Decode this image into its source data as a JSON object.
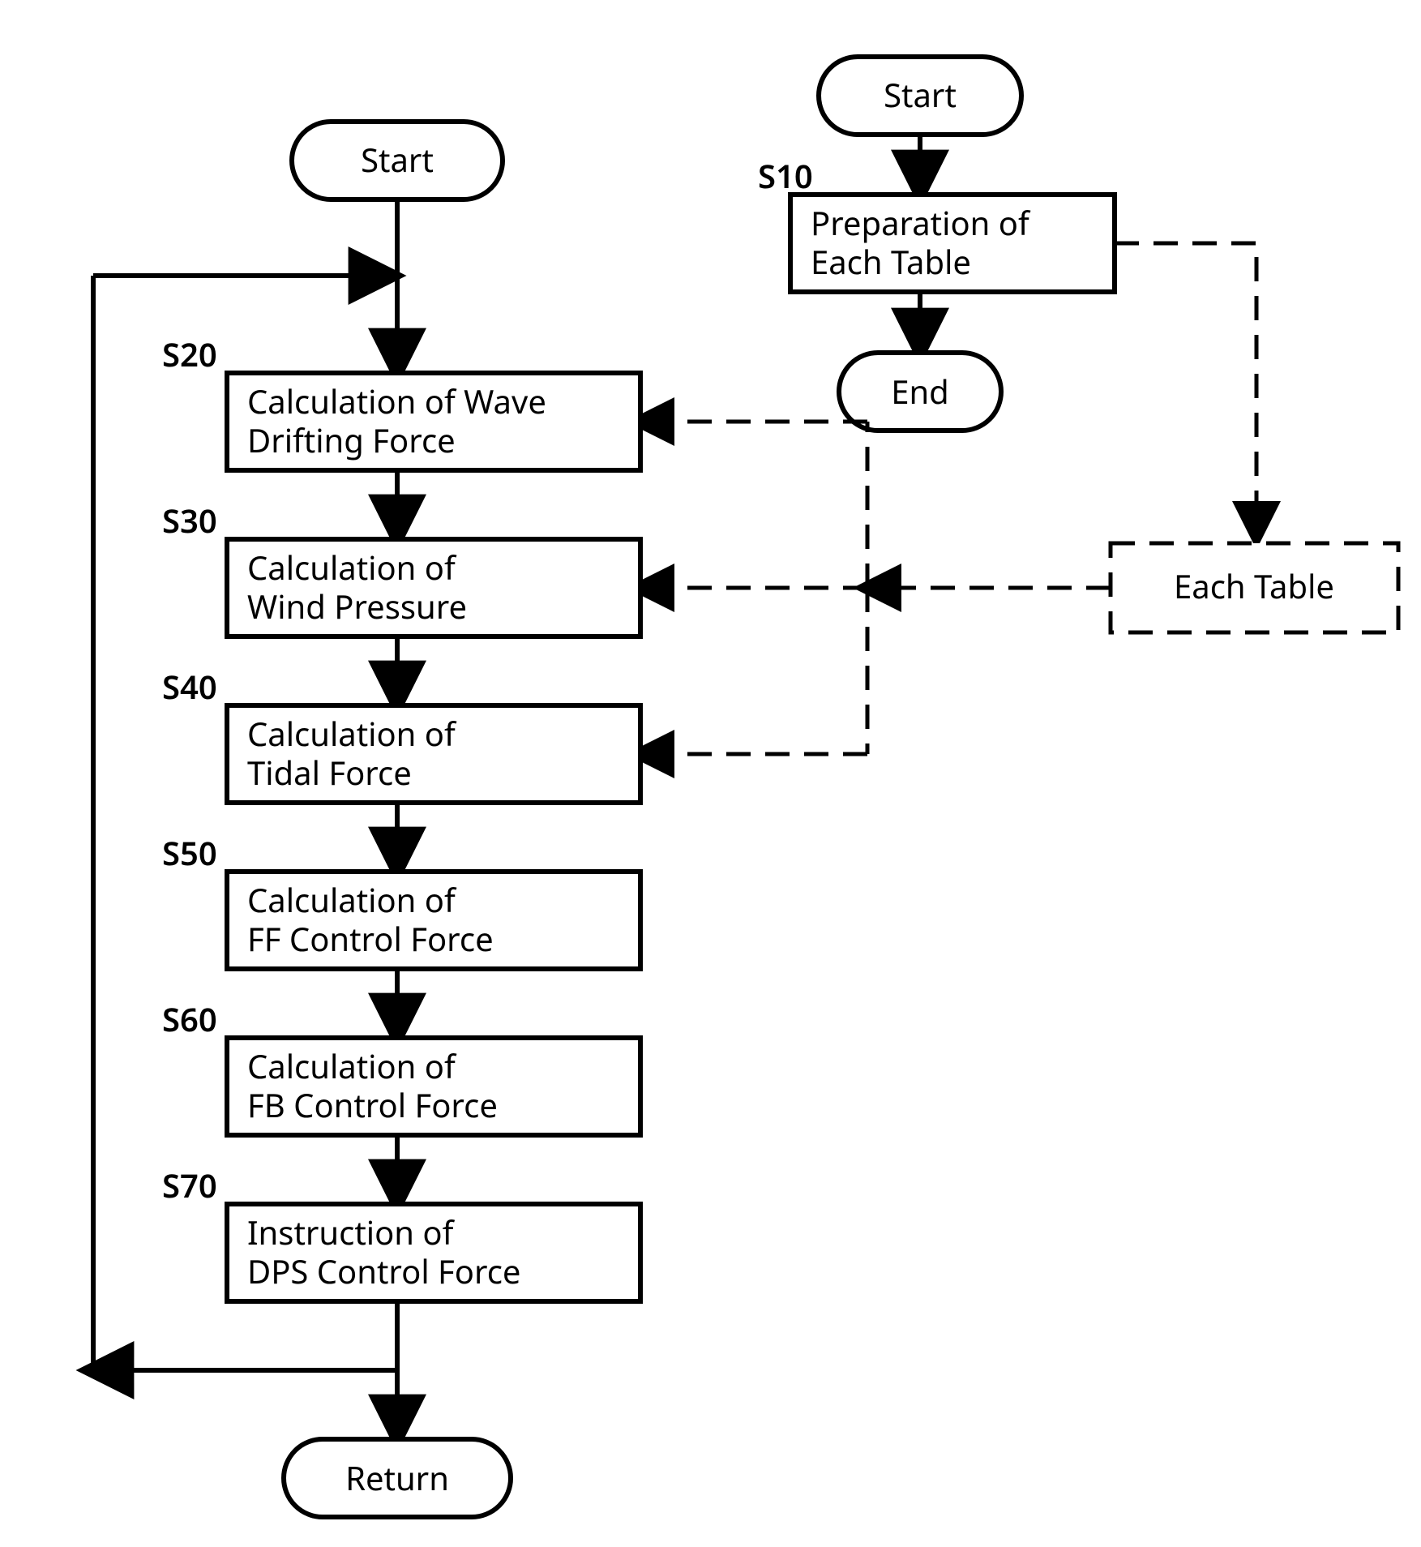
{
  "chart_data": {
    "type": "flowchart",
    "title": "",
    "right_flow": {
      "start": "Start",
      "steps": [
        {
          "id": "S10",
          "text_line1": "Preparation of",
          "text_line2": "Each Table"
        }
      ],
      "end": "End"
    },
    "main_flow": {
      "start": "Start",
      "steps": [
        {
          "id": "S20",
          "text_line1": "Calculation of Wave",
          "text_line2": "Drifting Force"
        },
        {
          "id": "S30",
          "text_line1": "Calculation of",
          "text_line2": "Wind Pressure"
        },
        {
          "id": "S40",
          "text_line1": "Calculation of",
          "text_line2": "Tidal Force"
        },
        {
          "id": "S50",
          "text_line1": "Calculation of",
          "text_line2": "FF Control Force"
        },
        {
          "id": "S60",
          "text_line1": "Calculation of",
          "text_line2": "FB Control Force"
        },
        {
          "id": "S70",
          "text_line1": "Instruction of",
          "text_line2": "DPS Control Force"
        }
      ],
      "end": "Return",
      "loops_back_to": "S20"
    },
    "side_box": {
      "text": "Each Table"
    },
    "dashed_refs": {
      "from_side_box_to": [
        "S20",
        "S30",
        "S40"
      ],
      "prep_to_side_box": true
    }
  }
}
